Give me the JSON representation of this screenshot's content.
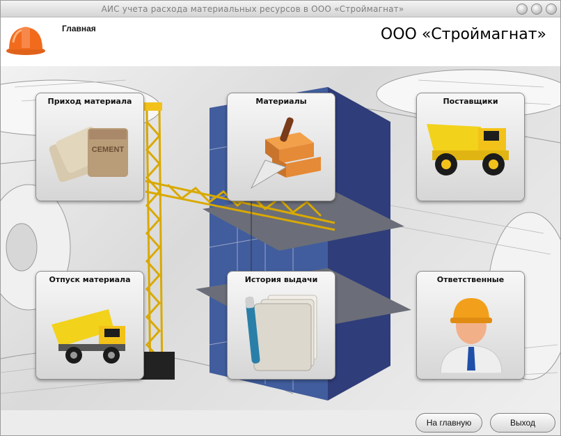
{
  "window": {
    "title": "АИС учета расхода материальных ресурсов в ООО «Строймагнат»"
  },
  "header": {
    "page_title": "Главная",
    "company_name": "ООО «Строймагнат»"
  },
  "tiles": [
    {
      "label": "Приход материала",
      "icon": "cement-bags-icon"
    },
    {
      "label": "Материалы",
      "icon": "bricks-trowel-icon"
    },
    {
      "label": "Поставщики",
      "icon": "dump-truck-icon"
    },
    {
      "label": "Отпуск материала",
      "icon": "dump-truck-tipping-icon"
    },
    {
      "label": "История выдачи",
      "icon": "documents-pen-icon"
    },
    {
      "label": "Ответственные",
      "icon": "worker-hardhat-icon"
    }
  ],
  "footer": {
    "home_label": "На главную",
    "exit_label": "Выход"
  },
  "colors": {
    "helmet": "#f26b1d",
    "crane": "#f2c21b",
    "glass": "#3e5fa8"
  }
}
